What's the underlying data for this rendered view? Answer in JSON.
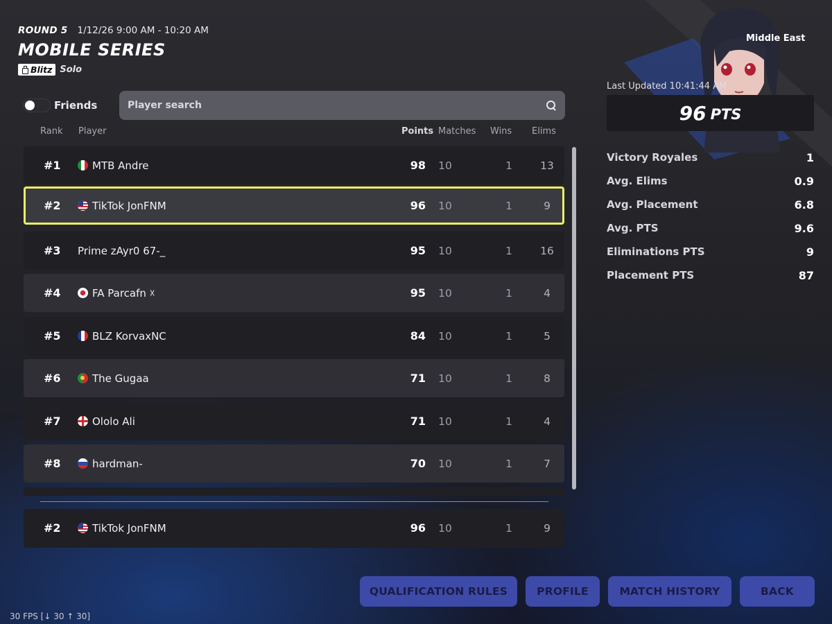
{
  "header": {
    "round": "ROUND 5",
    "time_range": "1/12/26 9:00 AM - 10:20 AM",
    "series_title": "MOBILE SERIES",
    "mode_badge": "Blitz",
    "mode_type": "Solo"
  },
  "filters": {
    "friends_label": "Friends",
    "friends_toggle_on": false,
    "search_placeholder": "Player search"
  },
  "columns": {
    "rank": "Rank",
    "player": "Player",
    "points": "Points",
    "matches": "Matches",
    "wins": "Wins",
    "elims": "Elims"
  },
  "leaderboard": [
    {
      "rank": "#1",
      "player": "MTB Andre",
      "flag": "italy",
      "points": "98",
      "matches": "10",
      "wins": "1",
      "elims": "13"
    },
    {
      "rank": "#2",
      "player": "TikTok JonFNM",
      "flag": "usa",
      "points": "96",
      "matches": "10",
      "wins": "1",
      "elims": "9"
    },
    {
      "rank": "#3",
      "player": "Prime zAyr0 67-_",
      "flag": "",
      "points": "95",
      "matches": "10",
      "wins": "1",
      "elims": "16"
    },
    {
      "rank": "#4",
      "player": "FA Parcafn ☓",
      "flag": "japan",
      "points": "95",
      "matches": "10",
      "wins": "1",
      "elims": "4"
    },
    {
      "rank": "#5",
      "player": "BLZ KorvaxNC",
      "flag": "france",
      "points": "84",
      "matches": "10",
      "wins": "1",
      "elims": "5"
    },
    {
      "rank": "#6",
      "player": "The Gugaa",
      "flag": "portugal",
      "points": "71",
      "matches": "10",
      "wins": "1",
      "elims": "8"
    },
    {
      "rank": "#7",
      "player": "Ololo Ali",
      "flag": "england",
      "points": "71",
      "matches": "10",
      "wins": "1",
      "elims": "4"
    },
    {
      "rank": "#8",
      "player": "hardman-",
      "flag": "russia",
      "points": "70",
      "matches": "10",
      "wins": "1",
      "elims": "7"
    }
  ],
  "pinned_player": {
    "rank": "#2",
    "player": "TikTok JonFNM",
    "flag": "usa",
    "points": "96",
    "matches": "10",
    "wins": "1",
    "elims": "9"
  },
  "side_panel": {
    "region": "Middle East",
    "last_updated": "Last Updated 10:41:44 AM",
    "points_value": "96",
    "points_unit": "PTS",
    "stats": [
      {
        "label": "Victory Royales",
        "value": "1"
      },
      {
        "label": "Avg. Elims",
        "value": "0.9"
      },
      {
        "label": "Avg. Placement",
        "value": "6.8"
      },
      {
        "label": "Avg. PTS",
        "value": "9.6"
      },
      {
        "label": "Eliminations PTS",
        "value": "9"
      },
      {
        "label": "Placement PTS",
        "value": "87"
      }
    ]
  },
  "buttons": {
    "qualification_rules": "QUALIFICATION RULES",
    "profile": "PROFILE",
    "match_history": "MATCH HISTORY",
    "back": "BACK"
  },
  "fps": "30 FPS [↓ 30 ↑ 30]",
  "colors": {
    "selected_outline": "#ecec6a",
    "button_bg": "#3d4aa8",
    "button_text": "#1a1c48"
  }
}
